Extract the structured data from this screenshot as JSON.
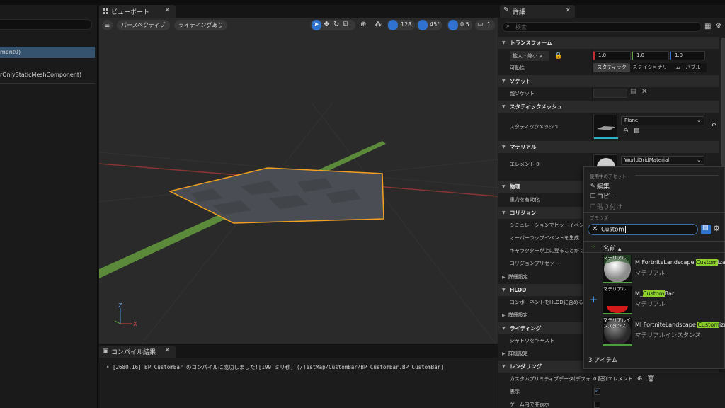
{
  "outliner": {
    "items": [
      {
        "label": "ment0)",
        "selected": true
      },
      {
        "label": "rOnlyStaticMeshComponent)",
        "selected": false
      }
    ]
  },
  "viewport": {
    "tab_label": "ビューポート",
    "perspective_label": "パースペクティブ",
    "lighting_label": "ライティングあり",
    "grid_size": "128",
    "rotation_snap": "45°",
    "scale_snap": "0.5",
    "camera_speed": "1"
  },
  "compile": {
    "tab_label": "コンパイル結果",
    "message": "[2680.16] BP_CustomBar のコンパイルに成功しました![199 ミリ秒] (/TestMap/CustomBar/BP_CustomBar.BP_CustomBar)"
  },
  "details": {
    "tab_label": "詳細",
    "search_placeholder": "検索",
    "transform": {
      "category": "トランスフォーム",
      "scale_label": "拡大・縮小",
      "scale_x": "1.0",
      "scale_y": "1.0",
      "scale_z": "1.0",
      "mobility_label": "可動性",
      "mobility_options": [
        "スタティック",
        "ステイショナリ",
        "ムーバブル"
      ]
    },
    "socket": {
      "category": "ソケット",
      "parent_label": "親ソケット"
    },
    "static_mesh": {
      "category": "スタティックメッシュ",
      "label": "スタティックメッシュ",
      "value": "Plane"
    },
    "material": {
      "category": "マテリアル",
      "element_label": "エレメント 0",
      "value": "WorldGridMaterial"
    },
    "physics": {
      "category": "物理",
      "gravity_label": "重力を有効化"
    },
    "collision": {
      "category": "コリジョン",
      "rows": [
        "シミュレーションでヒットイベント...",
        "オーバーラップイベントを生成",
        "キャラクターが上に登ることがで...",
        "コリジョンプリセット"
      ],
      "advanced": "詳細設定"
    },
    "hlod": {
      "category": "HLOD",
      "row": "コンポーネントをHLODに含める",
      "advanced": "詳細設定"
    },
    "lighting": {
      "category": "ライティング",
      "row": "シャドウをキャスト",
      "advanced": "詳細設定"
    },
    "rendering": {
      "category": "レンダリング",
      "custom_prim": "カスタムプリミティブデータ(デフォ...",
      "array_text": "0 配列エレメント",
      "visible": "表示",
      "hidden_in_game": "ゲーム内で非表示"
    }
  },
  "popup": {
    "current_asset_header": "使用中のアセット",
    "edit": "編集",
    "copy": "コピー",
    "paste": "貼り付け",
    "browse_header": "ブラウズ",
    "search_value": "Custom",
    "name_header": "名前",
    "assets": [
      {
        "thumb_label": "マテリアル",
        "pre": "M FortniteLandscape ",
        "hl": "Custom",
        "post": "izabl",
        "type": "マテリアル"
      },
      {
        "thumb_label": "マテリアル",
        "pre": "M_",
        "hl": "Custom",
        "post": "Bar",
        "type": "マテリアル"
      },
      {
        "thumb_label": "マテリアルイ ンスタンス",
        "pre": "MI FortniteLandscape ",
        "hl": "Custom",
        "post": "izab",
        "type": "マテリアルインスタンス"
      }
    ],
    "item_count": "3 アイテム"
  },
  "colors": {
    "accent_blue": "#2f72d0",
    "selection_orange": "#f2a020",
    "highlight_green": "#8cd12a",
    "grid_green": "#5a8a3a",
    "axis_red": "#a03a3a"
  }
}
